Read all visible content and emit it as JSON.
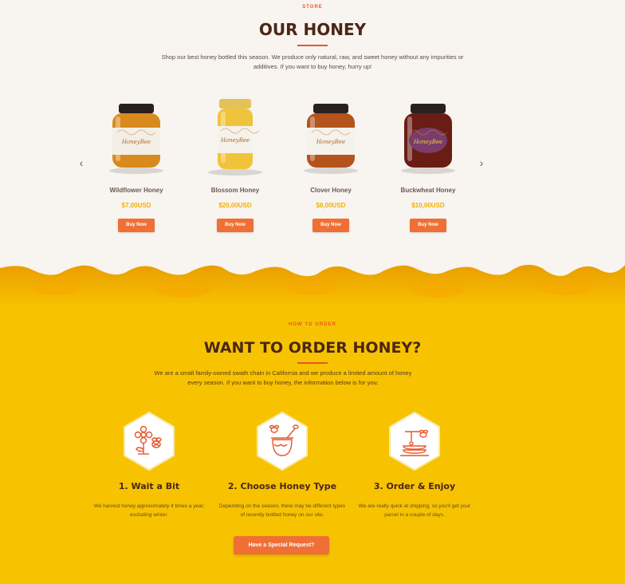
{
  "store": {
    "eyebrow": "STORE",
    "title": "OUR HONEY",
    "intro": "Shop our best honey bottled this season. We produce only natural, raw, and sweet honey without any impurities or additives. If you want to buy honey, hurry up!",
    "prev_icon": "chevron-left-icon",
    "next_icon": "chevron-right-icon",
    "products": [
      {
        "name": "Wildflower Honey",
        "price": "$7,00USD",
        "button": "Buy Now",
        "jar_brand": "HoneyBee",
        "honey_color": "#d98a1c",
        "label_color": "#f3efe6"
      },
      {
        "name": "Blossom Honey",
        "price": "$20,00USD",
        "button": "Buy Now",
        "jar_brand": "HoneyBee",
        "honey_color": "#f0c43a",
        "label_color": "#f5f2ec"
      },
      {
        "name": "Clover Honey",
        "price": "$8,00USD",
        "button": "Buy Now",
        "jar_brand": "HoneyBee",
        "honey_color": "#b4531c",
        "label_color": "#f5f2ec"
      },
      {
        "name": "Buckwheat Honey",
        "price": "$10,00USD",
        "button": "Buy Now",
        "jar_brand": "HoneyBee",
        "honey_color": "#6a1d15",
        "label_color": "#7a3d6a"
      }
    ]
  },
  "order": {
    "eyebrow": "HOW TO ORDER",
    "title": "WANT TO ORDER HONEY?",
    "intro": "We are a small family-owned swath chain in California and we produce a limited amount of honey every season. If you want to buy honey, the information below is for you:",
    "steps": [
      {
        "title": "1. Wait a Bit",
        "desc": "We harvest honey approximately 4 times a year, excluding winter.",
        "icon": "flower-bee-icon"
      },
      {
        "title": "2. Choose Honey Type",
        "desc": "Depending on the season, there may be different types of recently bottled honey on our site.",
        "icon": "honey-pot-icon"
      },
      {
        "title": "3. Order & Enjoy",
        "desc": "We are really quick at shipping, so you'll get your parcel in a couple of days.",
        "icon": "pancakes-honey-icon"
      }
    ],
    "cta": "Have a Special Request?"
  },
  "colors": {
    "accent": "#ef6f35",
    "brown": "#4a2617",
    "honey_yellow": "#f7c300",
    "price_gold": "#f2b000",
    "cream": "#f8f4ef"
  }
}
